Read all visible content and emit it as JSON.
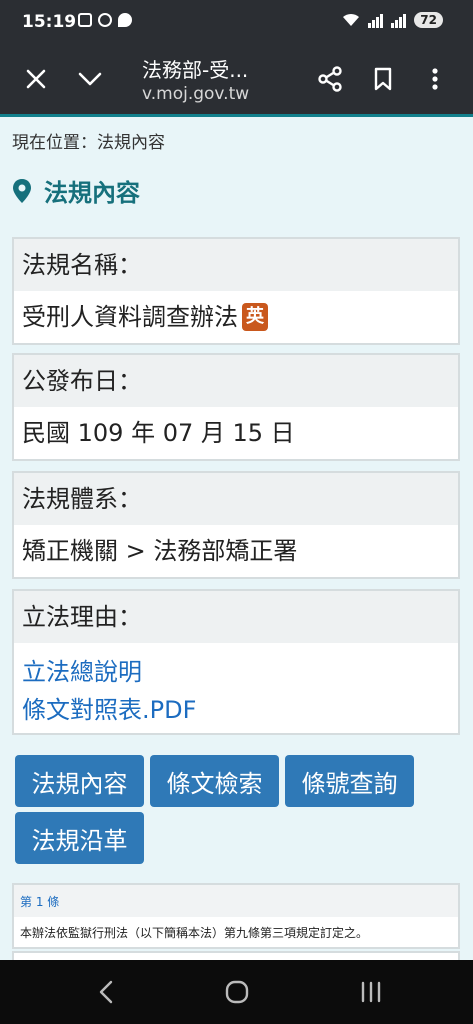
{
  "status_bar": {
    "time": "15:19",
    "battery": "72"
  },
  "browser": {
    "title": "法務部-受...",
    "url": "v.moj.gov.tw",
    "icons": [
      "close-icon",
      "chevron-down-icon",
      "share-icon",
      "bookmark-icon",
      "more-vert-icon"
    ]
  },
  "page": {
    "breadcrumb": "現在位置：法規內容",
    "heading": "法規內容",
    "law_name": {
      "label": "法規名稱：",
      "value": "受刑人資料調查辦法",
      "badge": "英"
    },
    "announce_date": {
      "label": "公發布日：",
      "value": "民國 109 年 07 月 15 日"
    },
    "law_system": {
      "label": "法規體系：",
      "value": "矯正機關 > 法務部矯正署"
    },
    "legislative_reason": {
      "label": "立法理由：",
      "links": [
        "立法總說明",
        "條文對照表.PDF"
      ]
    },
    "tabs": [
      "法規內容",
      "條文檢索",
      "條號查詢",
      "法規沿革"
    ],
    "article": {
      "number": "第 1 條",
      "text": "本辦法依監獄行刑法（以下簡稱本法）第九條第三項規定訂定之。"
    }
  },
  "colors": {
    "heading": "#16707c",
    "button": "#2f79b7",
    "link": "#1c6cc0",
    "badge": "#c9581d"
  }
}
